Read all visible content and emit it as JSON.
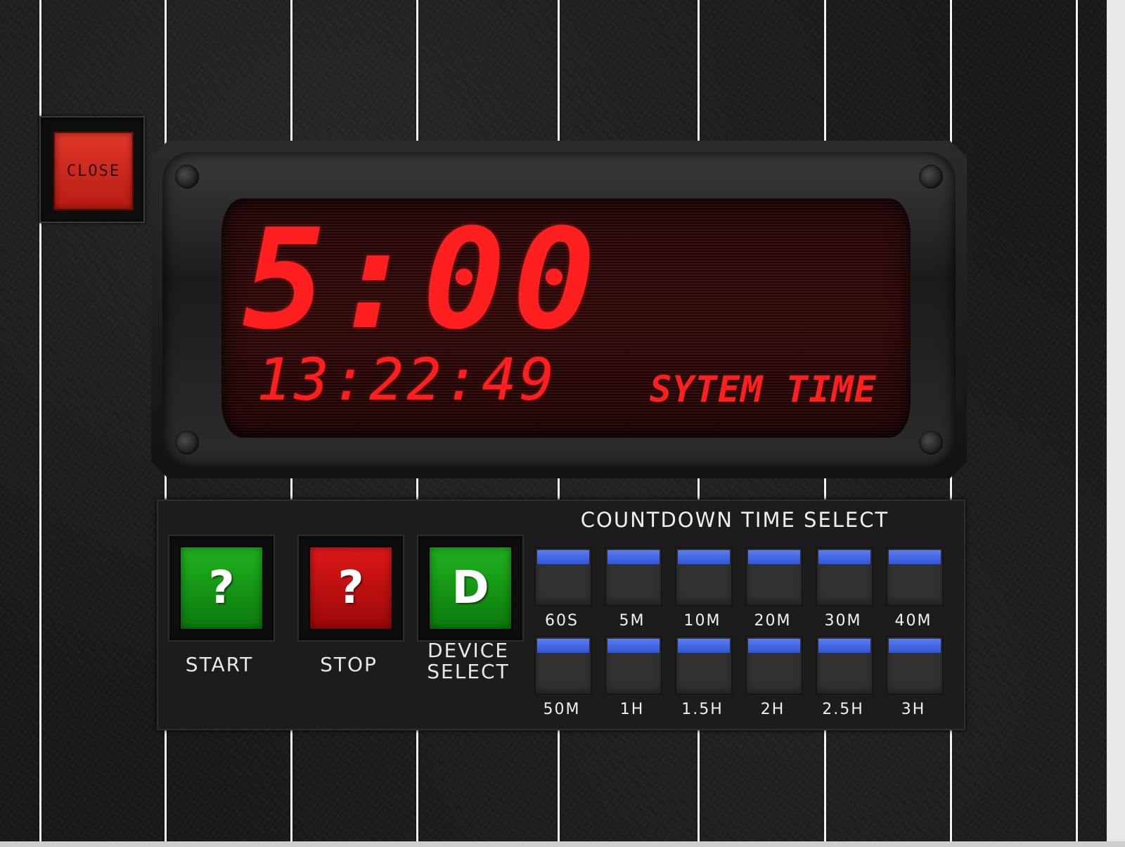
{
  "close_label": "CLOSE",
  "display": {
    "countdown": "5:00",
    "clock": "13:22:49",
    "clock_label": "SYTEM TIME"
  },
  "controls": {
    "start": {
      "glyph": "?",
      "label": "START"
    },
    "stop": {
      "glyph": "?",
      "label": "STOP"
    },
    "device": {
      "glyph": "D",
      "label_line1": "DEVICE",
      "label_line2": "SELECT"
    }
  },
  "countdown_select": {
    "title": "COUNTDOWN TIME SELECT",
    "options": [
      "60S",
      "5M",
      "10M",
      "20M",
      "30M",
      "40M",
      "50M",
      "1H",
      "1.5H",
      "2H",
      "2.5H",
      "3H"
    ]
  },
  "colors": {
    "display_red": "#ff1f1f",
    "start_green": "#1fb21f",
    "stop_red": "#e01818",
    "option_blue": "#3d63e0",
    "close_red": "#d22a1e"
  }
}
